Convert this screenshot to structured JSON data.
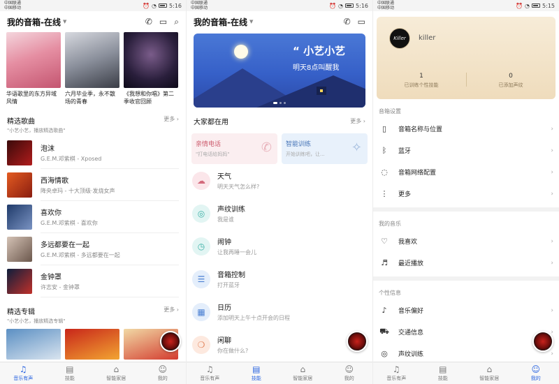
{
  "status": {
    "carrier1": "中国联通",
    "carrier2": "中国移动",
    "time1": "5:16",
    "time2": "5:16",
    "time3": "5:15"
  },
  "screen1": {
    "title": "我的音箱-在线",
    "banners": [
      {
        "caption": "华语歌里的东方异域风情"
      },
      {
        "caption": "六月毕业季，永不散场的青春"
      },
      {
        "caption": "《我想和你唱》第二季收官回顾"
      }
    ],
    "songs_section": {
      "title": "精选歌曲",
      "subtitle": "\"小艺小艺，播放精选歌曲\"",
      "more": "更多"
    },
    "songs": [
      {
        "title": "泡沫",
        "artist": "G.E.M.邓紫棋 - Xposed"
      },
      {
        "title": "西海情歌",
        "artist": "降央卓玛 - 十大顶级·发烧女声"
      },
      {
        "title": "喜欢你",
        "artist": "G.E.M.邓紫棋 - 喜欢你"
      },
      {
        "title": "多远都要在一起",
        "artist": "G.E.M.邓紫棋 - 多远都要在一起"
      },
      {
        "title": "金钟罩",
        "artist": "许志安 - 金钟罩"
      }
    ],
    "albums_section": {
      "title": "精选专辑",
      "subtitle": "\"小艺小艺，播放精选专辑\"",
      "more": "更多"
    }
  },
  "screen2": {
    "title": "我的音箱-在线",
    "hero": {
      "line1": "“ 小艺小艺",
      "line2": "明天8点叫醒我"
    },
    "section": {
      "title": "大家都在用",
      "more": "更多"
    },
    "cards": [
      {
        "title": "亲情电话",
        "sub": "\"打电话给妈妈\""
      },
      {
        "title": "智能训练",
        "sub": "开始训练吧，让..."
      }
    ],
    "features": [
      {
        "name": "天气",
        "desc": "明天天气怎么样?"
      },
      {
        "name": "声纹训练",
        "desc": "我是谁"
      },
      {
        "name": "闹钟",
        "desc": "让我再睡一会儿"
      },
      {
        "name": "音箱控制",
        "desc": "打开蓝牙"
      },
      {
        "name": "日历",
        "desc": "添加明天上午十点开会的日程"
      },
      {
        "name": "闲聊",
        "desc": "你在做什么?"
      }
    ]
  },
  "screen3": {
    "profile": {
      "avatar_text": "Killer",
      "name": "killer",
      "stats": [
        {
          "value": "1",
          "label": "已训练个性技能"
        },
        {
          "value": "0",
          "label": "已添加声纹"
        }
      ]
    },
    "groups": [
      {
        "title": "音箱设置",
        "items": [
          "音箱名称与位置",
          "蓝牙",
          "音箱网络配置",
          "更多"
        ]
      },
      {
        "title": "我的音乐",
        "items": [
          "我喜欢",
          "最近播放"
        ]
      },
      {
        "title": "个性信息",
        "items": [
          "音乐偏好",
          "交通信息",
          "声纹训练"
        ]
      }
    ]
  },
  "tabs": [
    "音乐有声",
    "技能",
    "智能家居",
    "我的"
  ]
}
